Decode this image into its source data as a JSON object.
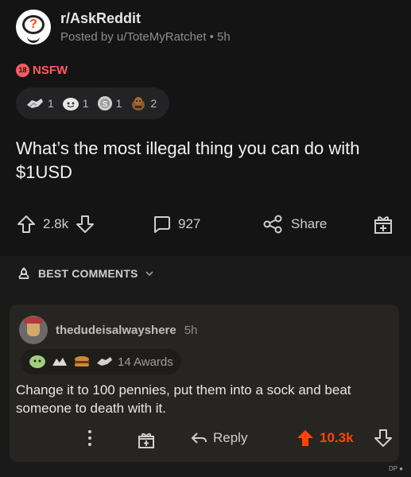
{
  "post": {
    "subreddit": "r/AskReddit",
    "posted_by": "Posted by u/ToteMyRatchet • 5h",
    "nsfw_tag": "NSFW",
    "nsfw_badge": "18",
    "awards": [
      {
        "icon": "helping-hand-icon",
        "count": "1"
      },
      {
        "icon": "wholesome-icon",
        "count": "1"
      },
      {
        "icon": "silver-coin-icon",
        "count": "1"
      },
      {
        "icon": "dog-award-icon",
        "count": "2"
      }
    ],
    "title": "What’s the most illegal thing you can do with $1USD",
    "score": "2.8k",
    "comments": "927",
    "share_label": "Share"
  },
  "sort": {
    "label": "BEST COMMENTS"
  },
  "comment": {
    "username": "thedudeisalwayshere",
    "time": "5h",
    "awards_label": "14 Awards",
    "body": "Change it to 100 pennies, put them into a sock and beat someone to death with it.",
    "reply_label": "Reply",
    "score": "10.3k"
  },
  "watermark": "DP ●",
  "colors": {
    "accent_orange": "#ff4500",
    "nsfw_red": "#ff5a5f",
    "post_bg": "#141415",
    "comment_bg": "#262521"
  }
}
